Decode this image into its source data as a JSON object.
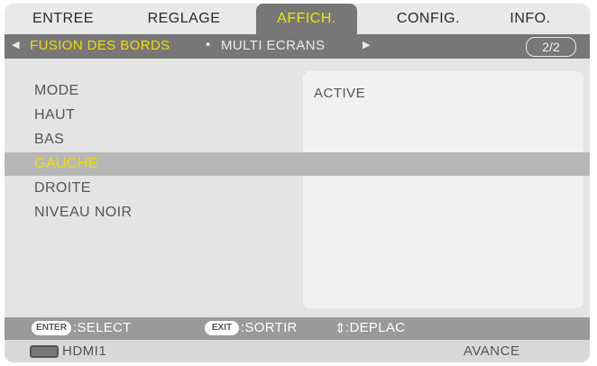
{
  "tabs": [
    {
      "label": "ENTREE"
    },
    {
      "label": "REGLAGE"
    },
    {
      "label": "AFFICH."
    },
    {
      "label": "CONFIG."
    },
    {
      "label": "INFO."
    }
  ],
  "active_tab": "AFFICH.",
  "subpages": {
    "active": "FUSION DES BORDS",
    "next": "MULTI ECRANS",
    "page_indicator": "2/2"
  },
  "menu": {
    "items": [
      {
        "label": "MODE"
      },
      {
        "label": "HAUT"
      },
      {
        "label": "BAS"
      },
      {
        "label": "GAUCHE"
      },
      {
        "label": "DROITE"
      },
      {
        "label": "NIVEAU NOIR"
      }
    ],
    "selected": "GAUCHE",
    "value": "ACTIVE"
  },
  "help": {
    "enter_key": "ENTER",
    "enter_text": ":SELECT",
    "exit_key": "EXIT",
    "exit_text": ":SORTIR",
    "move_symbol": "⇕",
    "move_text": ":DEPLAC"
  },
  "status": {
    "source": "HDMI1",
    "mode": "AVANCE"
  },
  "colors": {
    "highlight_text": "#f0dd00",
    "active_tab_bg": "#777777",
    "selected_row_bg": "#b8b8b8",
    "panel_bg": "#e4e4e4"
  },
  "icons": [
    "left-arrow-icon",
    "right-arrow-icon",
    "hdmi-icon",
    "updown-arrow-icon"
  ]
}
